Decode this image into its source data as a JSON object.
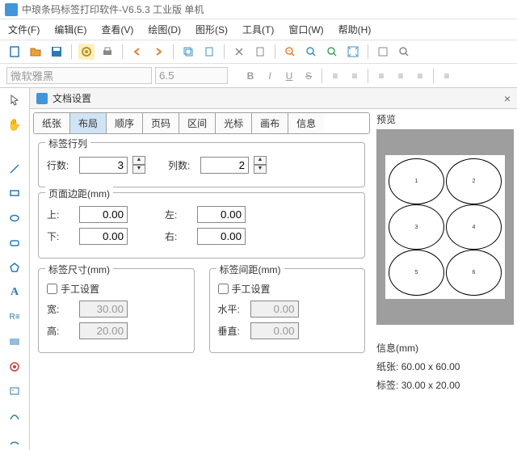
{
  "app": {
    "title": "中琅条码标签打印软件-V6.5.3 工业版 单机"
  },
  "menu": {
    "file": "文件(F)",
    "edit": "编辑(E)",
    "view": "查看(V)",
    "draw": "绘图(D)",
    "shape": "图形(S)",
    "tool": "工具(T)",
    "window": "窗口(W)",
    "help": "帮助(H)"
  },
  "fmt": {
    "font": "微软雅黑",
    "size": "6.5",
    "b": "B",
    "i": "I",
    "u": "U",
    "s": "S"
  },
  "dlg": {
    "title": "文档设置",
    "tabs": {
      "paper": "纸张",
      "layout": "布局",
      "order": "顺序",
      "pageno": "页码",
      "range": "区间",
      "cursor": "光标",
      "canvas": "画布",
      "info": "信息"
    },
    "g1": {
      "title": "标签行列",
      "rows_lbl": "行数:",
      "cols_lbl": "列数:",
      "rows": "3",
      "cols": "2"
    },
    "g2": {
      "title": "页面边距(mm)",
      "top": "上:",
      "left": "左:",
      "bottom": "下:",
      "right": "右:",
      "v": "0.00"
    },
    "g3": {
      "title": "标签尺寸(mm)",
      "manual": "手工设置",
      "w": "宽:",
      "h": "高:",
      "wv": "30.00",
      "hv": "20.00"
    },
    "g4": {
      "title": "标签间距(mm)",
      "manual": "手工设置",
      "hz": "水平:",
      "vt": "垂直:",
      "v": "0.00"
    },
    "preview": "预览",
    "info": {
      "title": "信息(mm)",
      "paper_lbl": "纸张:",
      "paper_v": "60.00 x 60.00",
      "label_lbl": "标签:",
      "label_v": "30.00 x 20.00"
    }
  }
}
